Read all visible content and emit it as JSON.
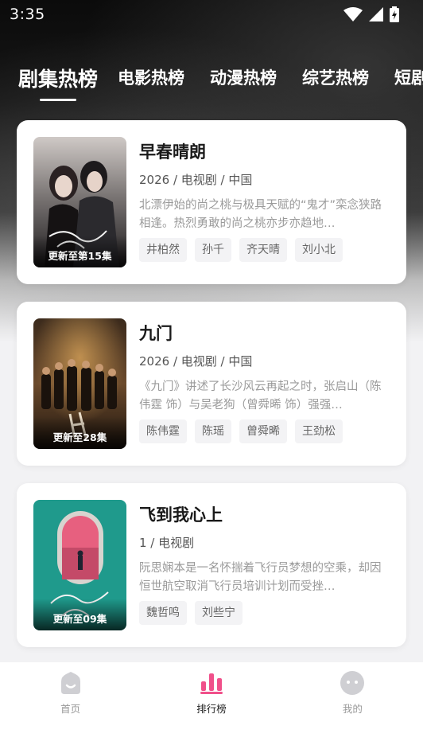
{
  "status_bar": {
    "time": "3:35"
  },
  "tabs": [
    {
      "label": "剧集热榜",
      "active": true
    },
    {
      "label": "电影热榜",
      "active": false
    },
    {
      "label": "动漫热榜",
      "active": false
    },
    {
      "label": "综艺热榜",
      "active": false
    },
    {
      "label": "短剧",
      "active": false
    }
  ],
  "cards": [
    {
      "title": "早春晴朗",
      "meta": "2026 / 电视剧 / 中国",
      "description": "北漂伊始的尚之桃与极具天赋的“鬼才”栾念狭路相逢。热烈勇敢的尚之桃亦步亦趋地…",
      "badge": "更新至第15集",
      "tags": [
        "井柏然",
        "孙千",
        "齐天晴",
        "刘小北"
      ]
    },
    {
      "title": "九门",
      "meta": "2026 / 电视剧 / 中国",
      "description": "《九门》讲述了长沙风云再起之时，张启山（陈伟霆 饰）与吴老狗（曾舜晞 饰）强强…",
      "badge": "更新至28集",
      "tags": [
        "陈伟霆",
        "陈瑶",
        "曾舜晞",
        "王劲松"
      ]
    },
    {
      "title": "飞到我心上",
      "meta": "1 / 电视剧",
      "description": "阮思娴本是一名怀揣着飞行员梦想的空乘，却因恒世航空取消飞行员培训计划而受挫…",
      "badge": "更新至09集",
      "tags": [
        "魏哲鸣",
        "刘些宁"
      ]
    }
  ],
  "bottom_nav": [
    {
      "label": "首页",
      "icon": "home-icon",
      "active": false
    },
    {
      "label": "排行榜",
      "icon": "ranking-icon",
      "active": true
    },
    {
      "label": "我的",
      "icon": "profile-icon",
      "active": false
    }
  ],
  "colors": {
    "accent": "#f0508a",
    "inactive_icon": "#cfcfd3"
  }
}
